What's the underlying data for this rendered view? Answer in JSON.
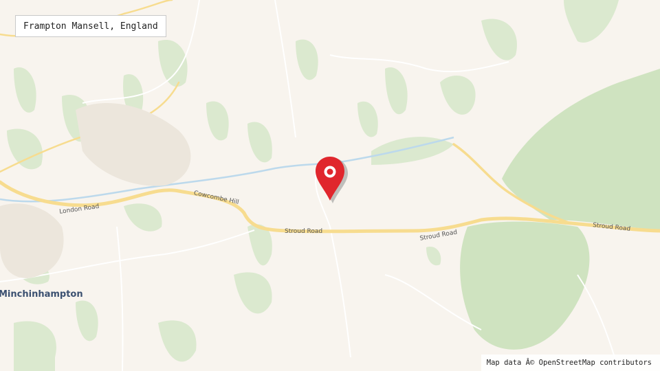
{
  "location_label": "Frampton Mansell, England",
  "attribution": "Map data Â© OpenStreetMap contributors",
  "places": [
    {
      "name": "Minchinhampton"
    }
  ],
  "roads": [
    {
      "name": "London Road"
    },
    {
      "name": "Cowcombe Hill"
    },
    {
      "name": "Stroud Road"
    },
    {
      "name": "Stroud Road"
    },
    {
      "name": "Stroud Road"
    }
  ],
  "marker": {
    "icon": "map-pin-icon",
    "color": "#e0262d"
  },
  "colors": {
    "background": "#f8f4ee",
    "woodland": "#dbe9cf",
    "woodland_dark": "#cfe3c0",
    "major_road": "#f7dc8f",
    "minor_road": "#ffffff",
    "water": "#bcd9ec"
  }
}
